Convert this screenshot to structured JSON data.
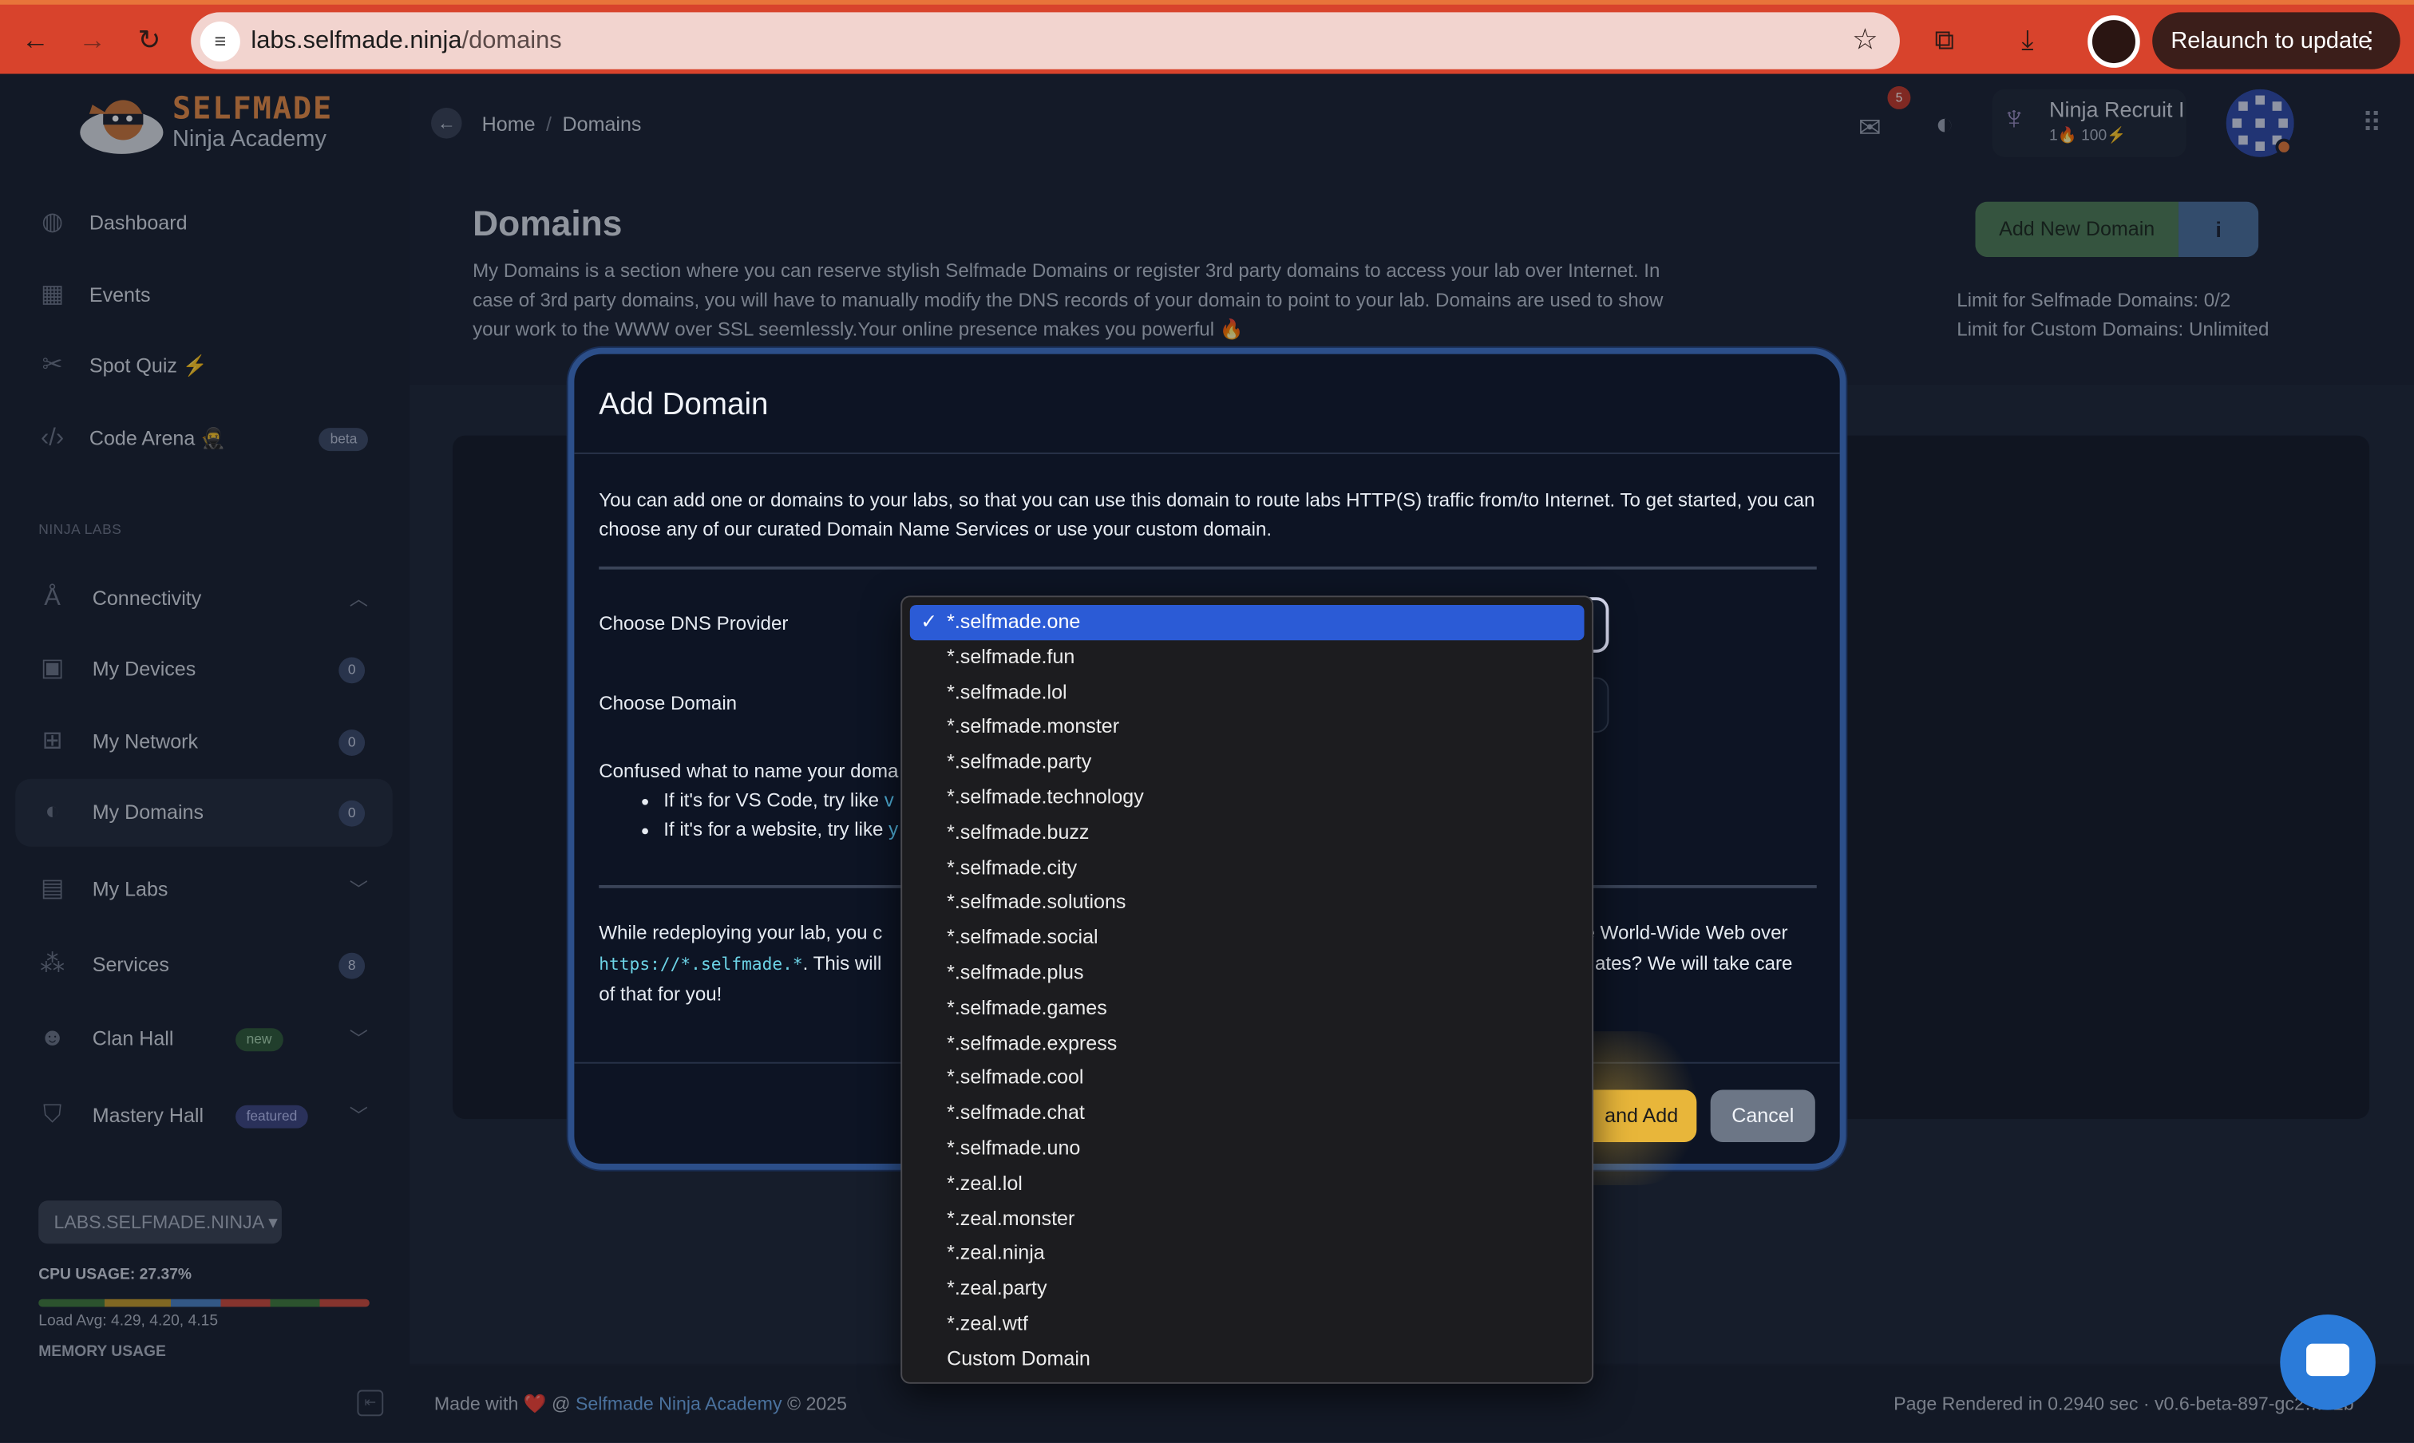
{
  "browser": {
    "url_host": "labs.selfmade.ninja",
    "url_path": "/domains",
    "relaunch_label": "Relaunch to update"
  },
  "brand": {
    "name": "SELFMADE",
    "sub": "Ninja Academy"
  },
  "sidebar": {
    "items_top": [
      {
        "label": "Dashboard"
      },
      {
        "label": "Events"
      },
      {
        "label": "Spot Quiz ⚡"
      },
      {
        "label": "Code Arena 🥷",
        "badge": "beta"
      }
    ],
    "section_heading": "NINJA LABS",
    "items_labs": [
      {
        "label": "Connectivity"
      },
      {
        "label": "My Devices",
        "count": "0"
      },
      {
        "label": "My Network",
        "count": "0"
      },
      {
        "label": "My Domains",
        "count": "0"
      },
      {
        "label": "My Labs"
      },
      {
        "label": "Services",
        "count": "8"
      },
      {
        "label": "Clan Hall",
        "badge": "new"
      },
      {
        "label": "Mastery Hall",
        "badge": "featured"
      }
    ],
    "labs_button": "LABS.SELFMADE.NINJA",
    "cpu_usage": "CPU USAGE: 27.37%",
    "load_avg": "Load Avg: 4.29, 4.20, 4.15",
    "memory_usage": "MEMORY USAGE"
  },
  "topbar": {
    "breadcrumb_home": "Home",
    "breadcrumb_sep": "/",
    "breadcrumb_current": "Domains",
    "mail_count": "5",
    "user_name": "Ninja Recruit I",
    "user_stats": "1🔥 100⚡"
  },
  "page": {
    "title": "Domains",
    "description": "My Domains is a section where you can reserve stylish Selfmade Domains or register 3rd party domains to access your lab over Internet. In case of 3rd party domains, you will have to manually modify the DNS records of your domain to point to your lab. Domains are used to show your work to the WWW over SSL seemlessly.Your online presence makes you powerful 🔥",
    "add_button": "Add New Domain",
    "info_button": "i",
    "limit_selfmade": "Limit for Selfmade Domains: 0/2",
    "limit_custom": "Limit for Custom Domains: Unlimited"
  },
  "modal": {
    "title": "Add Domain",
    "intro": "You can add one or domains to your labs, so that you can use this domain to route labs HTTP(S) traffic from/to Internet. To get started, you can choose any of our curated Domain Name Services or use your custom domain.",
    "label_provider": "Choose DNS Provider",
    "label_domain": "Choose Domain",
    "confused_prefix": "Confused what to name your doma",
    "tip1_prefix": "If it's for VS Code, try like ",
    "tip1_code": "v",
    "tip2_prefix": "If it's for a website, try like ",
    "tip2_code": "y",
    "para_line1_a": "While redeploying your lab, you c",
    "para_line1_b": "e World-Wide Web over",
    "para_code": "https://*.selfmade.*",
    "para_line2_a": ". This will",
    "para_line2_b": "ates? We will take care",
    "para_line3": "of that for you!",
    "save_label": "and Add",
    "cancel_label": "Cancel"
  },
  "dropdown": {
    "selected_index": 0,
    "options": [
      "*.selfmade.one",
      "*.selfmade.fun",
      "*.selfmade.lol",
      "*.selfmade.monster",
      "*.selfmade.party",
      "*.selfmade.technology",
      "*.selfmade.buzz",
      "*.selfmade.city",
      "*.selfmade.solutions",
      "*.selfmade.social",
      "*.selfmade.plus",
      "*.selfmade.games",
      "*.selfmade.express",
      "*.selfmade.cool",
      "*.selfmade.chat",
      "*.selfmade.uno",
      "*.zeal.lol",
      "*.zeal.monster",
      "*.zeal.ninja",
      "*.zeal.party",
      "*.zeal.wtf",
      "Custom Domain"
    ]
  },
  "footer": {
    "made_with": "Made with ❤️ @ ",
    "academy_link": "Selfmade Ninja Academy",
    "year": " © 2025",
    "render_info": "Page Rendered in 0.2940 sec · v0.6-beta-897-gc2…42b"
  },
  "colors": {
    "accent": "#2b5bd6",
    "brand": "#e58a45",
    "chrome": "#d8432c"
  }
}
